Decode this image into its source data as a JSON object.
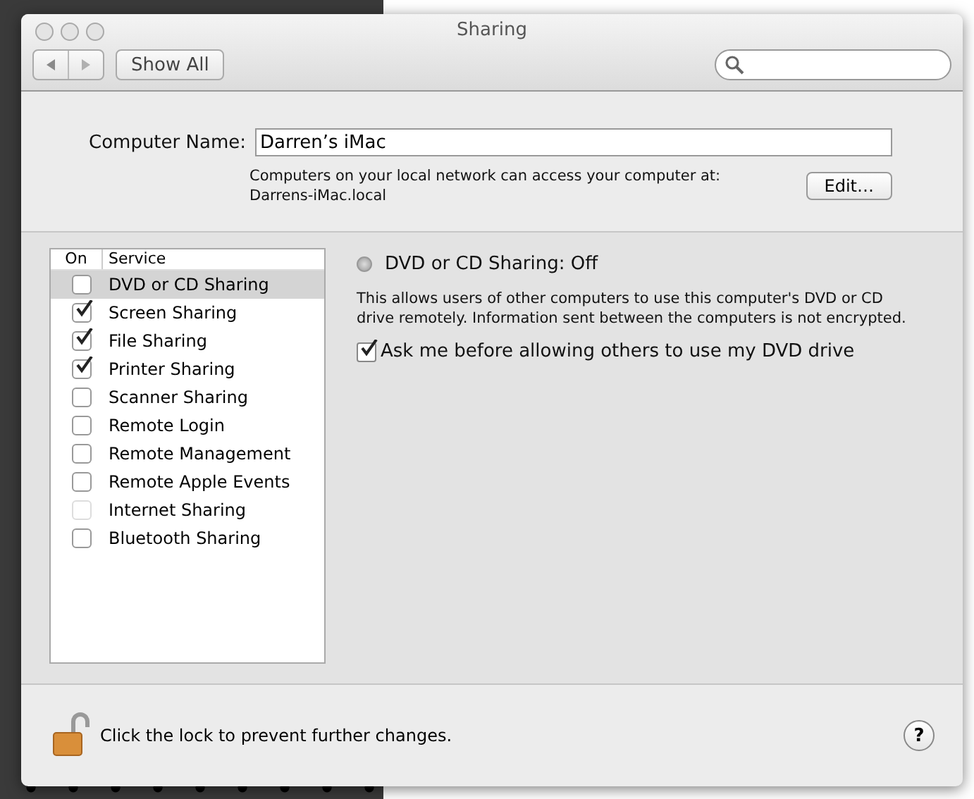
{
  "window": {
    "title": "Sharing"
  },
  "toolbar": {
    "show_all": "Show All"
  },
  "computer_name": {
    "label": "Computer Name:",
    "value": "Darren’s iMac",
    "info": "Computers on your local network can access your computer at:",
    "address": "Darrens-iMac.local",
    "edit_button": "Edit…"
  },
  "services": {
    "columns": [
      "On",
      "Service"
    ],
    "rows": [
      {
        "name": "DVD or CD Sharing",
        "checked": false,
        "selected": true,
        "disabled": false
      },
      {
        "name": "Screen Sharing",
        "checked": true,
        "selected": false,
        "disabled": false
      },
      {
        "name": "File Sharing",
        "checked": true,
        "selected": false,
        "disabled": false
      },
      {
        "name": "Printer Sharing",
        "checked": true,
        "selected": false,
        "disabled": false
      },
      {
        "name": "Scanner Sharing",
        "checked": false,
        "selected": false,
        "disabled": false
      },
      {
        "name": "Remote Login",
        "checked": false,
        "selected": false,
        "disabled": false
      },
      {
        "name": "Remote Management",
        "checked": false,
        "selected": false,
        "disabled": false
      },
      {
        "name": "Remote Apple Events",
        "checked": false,
        "selected": false,
        "disabled": false
      },
      {
        "name": "Internet Sharing",
        "checked": false,
        "selected": false,
        "disabled": true
      },
      {
        "name": "Bluetooth Sharing",
        "checked": false,
        "selected": false,
        "disabled": false
      }
    ]
  },
  "detail": {
    "status": "DVD or CD Sharing: Off",
    "status_on": false,
    "description": "This allows users of other computers to use this computer's DVD or CD drive remotely. Information sent between the computers is not encrypted.",
    "option": {
      "label": "Ask me before allowing others to use my DVD drive",
      "checked": true
    }
  },
  "footer": {
    "lock_text": "Click the lock to prevent further changes.",
    "locked": false,
    "help": "?"
  }
}
